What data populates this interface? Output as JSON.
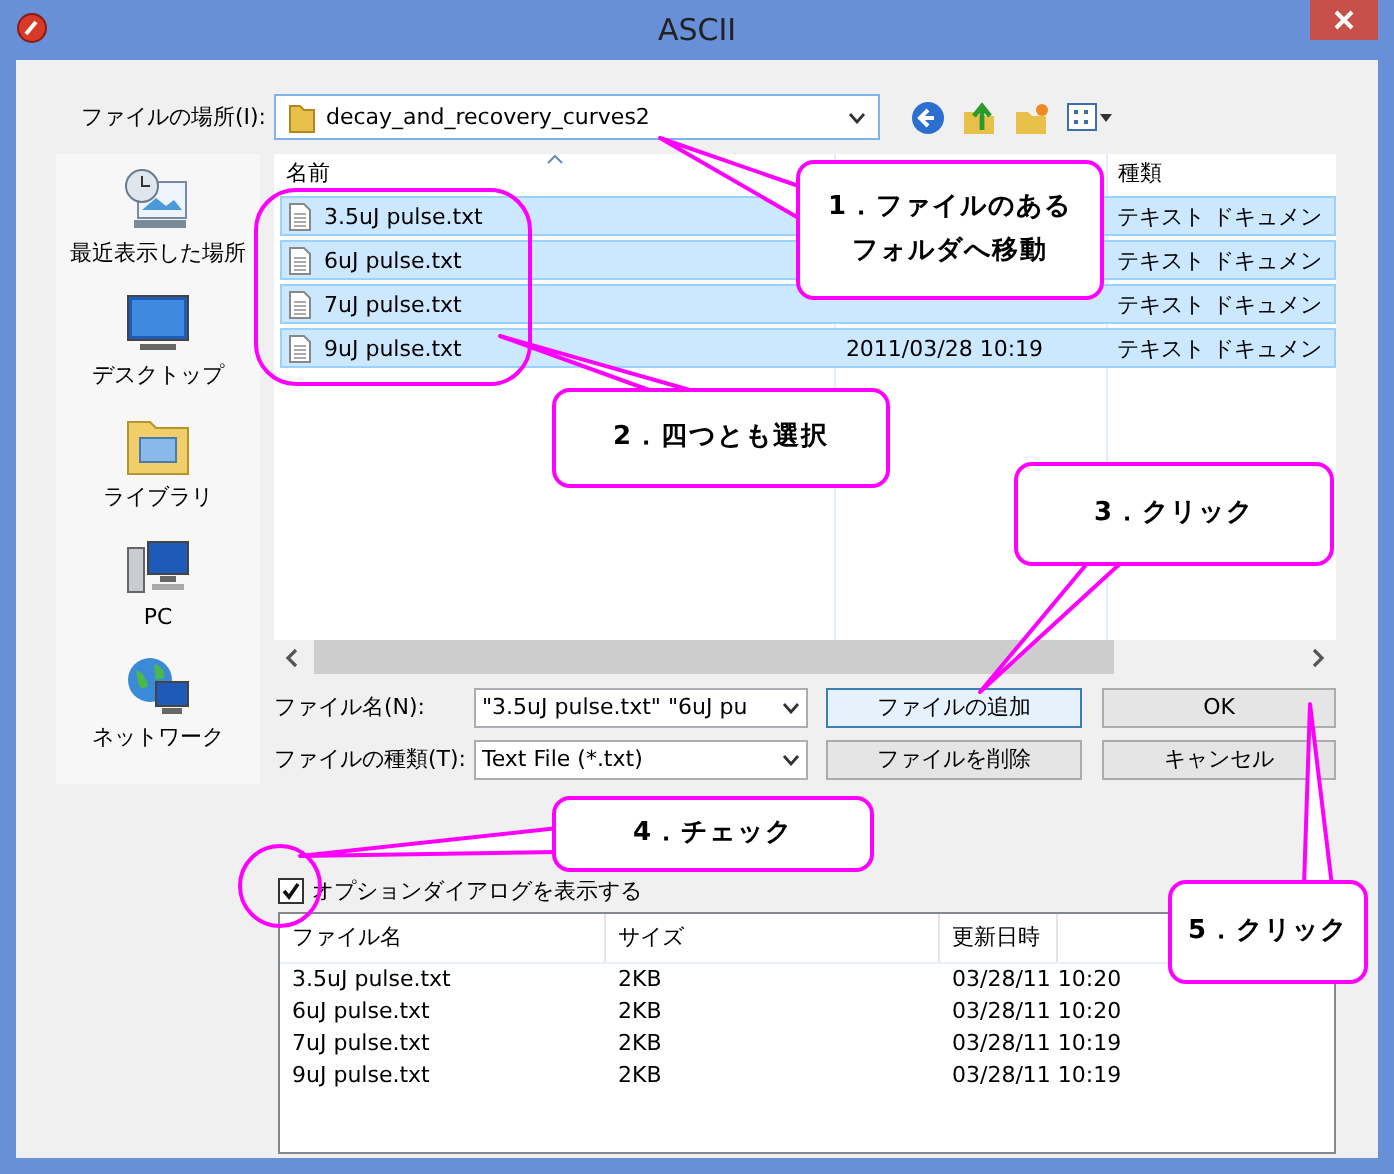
{
  "window": {
    "title": "ASCII"
  },
  "location": {
    "label": "ファイルの場所(I):",
    "value": "decay_and_recovery_curves2"
  },
  "places": [
    {
      "kind": "recent",
      "label": "最近表示した場所"
    },
    {
      "kind": "desktop",
      "label": "デスクトップ"
    },
    {
      "kind": "library",
      "label": "ライブラリ"
    },
    {
      "kind": "pc",
      "label": "PC"
    },
    {
      "kind": "network",
      "label": "ネットワーク"
    }
  ],
  "file_list": {
    "name_header": "名前",
    "type_header": "種類",
    "rows": [
      {
        "name": "3.5uJ pulse.txt",
        "selected": true,
        "type": "テキスト ドキュメン"
      },
      {
        "name": "6uJ pulse.txt",
        "selected": true,
        "type": "テキスト ドキュメン"
      },
      {
        "name": "7uJ pulse.txt",
        "selected": true,
        "type": "テキスト ドキュメン"
      },
      {
        "name": "9uJ pulse.txt",
        "selected": true,
        "date": "2011/03/28 10:19",
        "type": "テキスト ドキュメン"
      }
    ]
  },
  "file_name": {
    "label": "ファイル名(N):",
    "value": "\"3.5uJ pulse.txt\" \"6uJ pu"
  },
  "file_type": {
    "label": "ファイルの種類(T):",
    "value": "Text File (*.txt)"
  },
  "buttons": [
    {
      "label": "ファイルの追加",
      "focused": true
    },
    {
      "label": "OK",
      "focused": false
    },
    {
      "label": "ファイルを削除",
      "focused": false
    },
    {
      "label": "キャンセル",
      "focused": false
    }
  ],
  "option_checkbox": {
    "label": "オプションダイアログを表示する",
    "checked": true
  },
  "selected_files": {
    "columns": [
      "ファイル名",
      "サイズ",
      "更新日時"
    ],
    "rows": [
      {
        "name": "3.5uJ pulse.txt",
        "size": "2KB",
        "date": "03/28/11 10:20"
      },
      {
        "name": "6uJ pulse.txt",
        "size": "2KB",
        "date": "03/28/11 10:20"
      },
      {
        "name": "7uJ pulse.txt",
        "size": "2KB",
        "date": "03/28/11 10:19"
      },
      {
        "name": "9uJ pulse.txt",
        "size": "2KB",
        "date": "03/28/11 10:19"
      }
    ]
  },
  "callouts": [
    {
      "lines": [
        "1．ファイルのある",
        "フォルダへ移動"
      ]
    },
    {
      "lines": [
        "2．四つとも選択"
      ]
    },
    {
      "lines": [
        "3．クリック"
      ]
    },
    {
      "lines": [
        "4．チェック"
      ]
    },
    {
      "lines": [
        "5．クリック"
      ]
    }
  ]
}
